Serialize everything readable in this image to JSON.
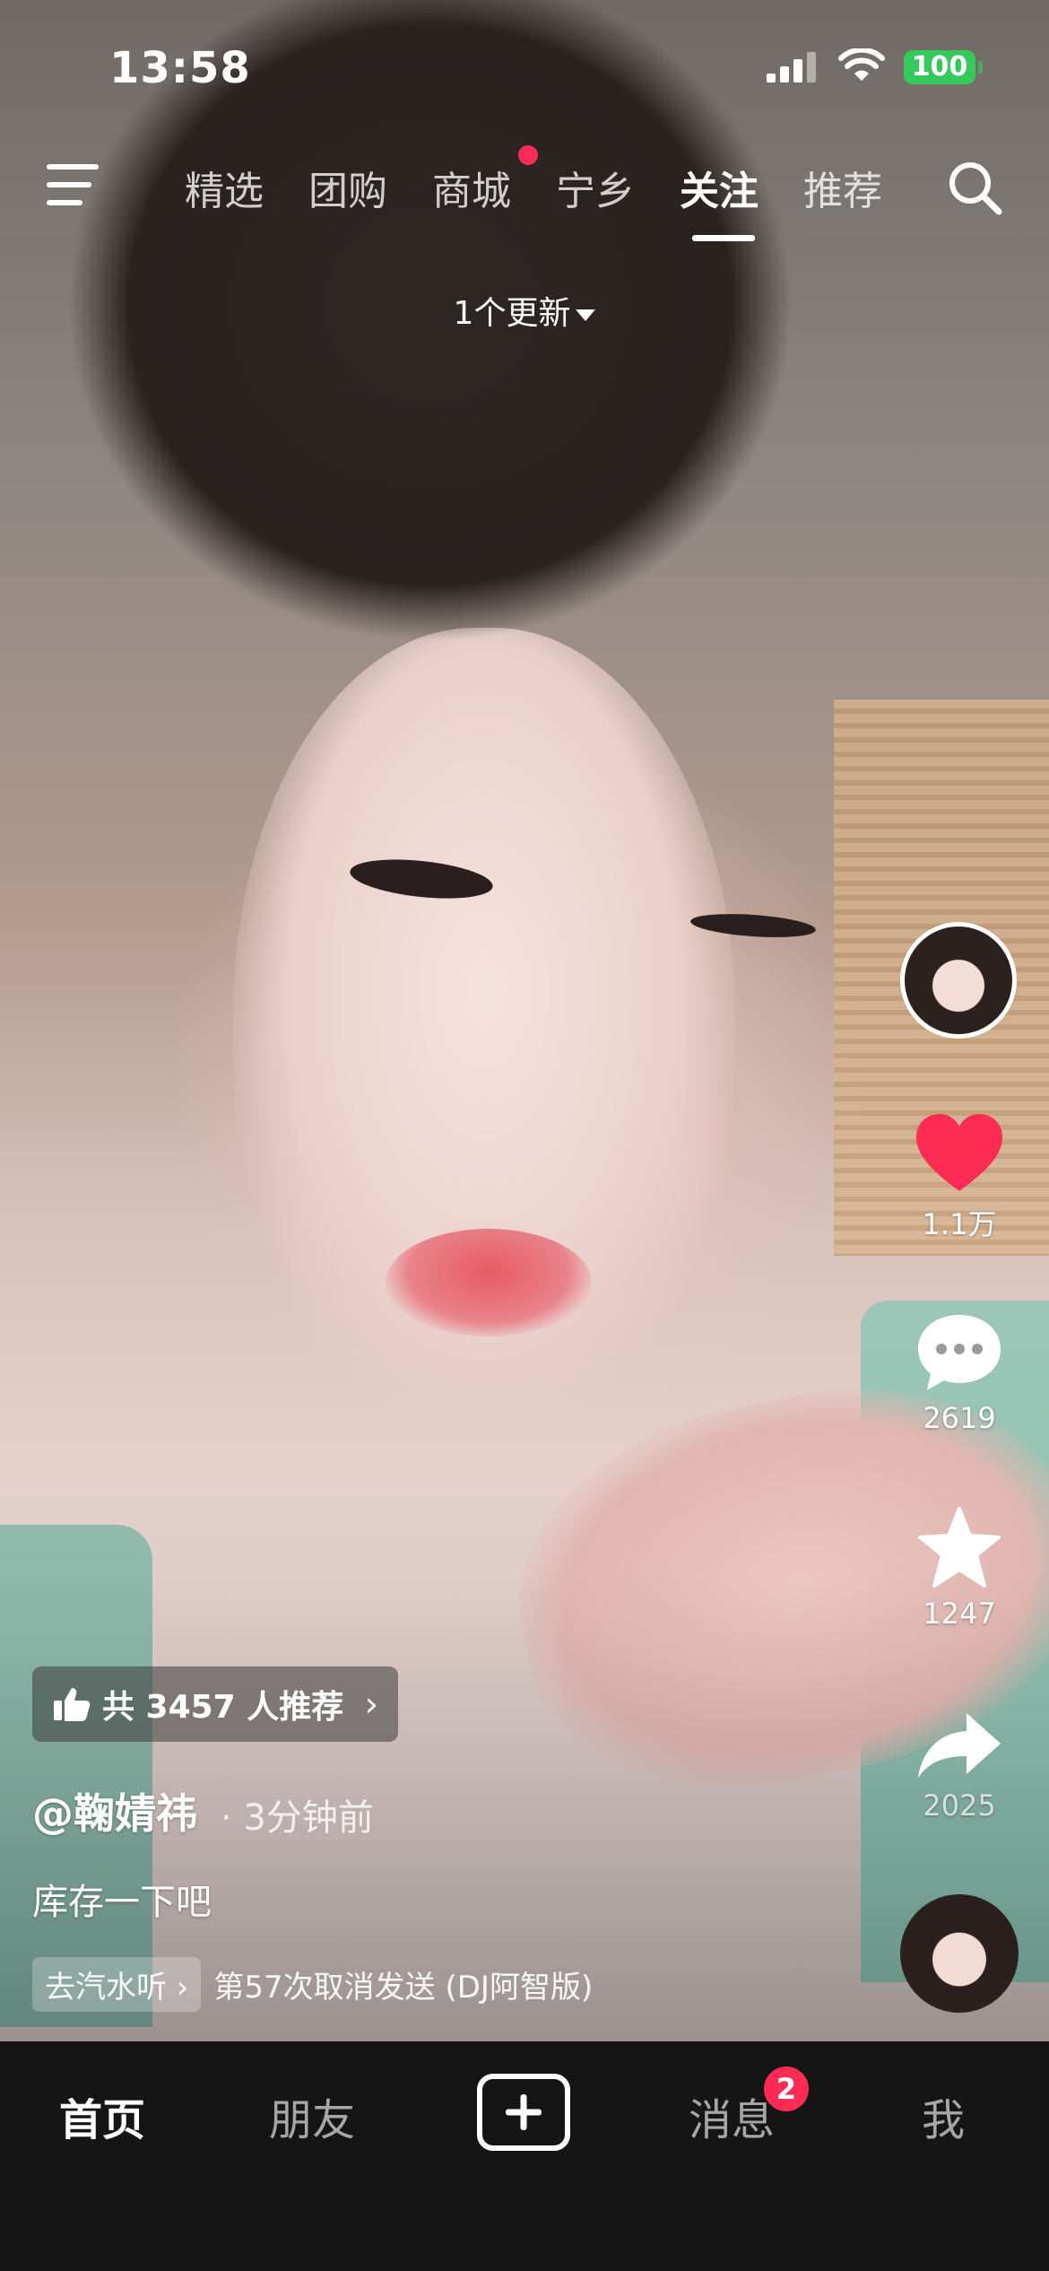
{
  "status_bar": {
    "time": "13:58",
    "battery": "100"
  },
  "top_nav": {
    "tabs": [
      {
        "label": "精选"
      },
      {
        "label": "团购"
      },
      {
        "label": "商城"
      },
      {
        "label": "宁乡"
      },
      {
        "label": "关注"
      },
      {
        "label": "推荐"
      }
    ],
    "active_tab": "关注"
  },
  "update_banner": {
    "text": "1个更新"
  },
  "right_rail": {
    "likes": "1.1万",
    "comments": "2619",
    "favorites": "1247",
    "shares": "2025"
  },
  "post": {
    "recommend_text": "共 3457 人推荐",
    "author": "@鞠婧祎",
    "time": "· 3分钟前",
    "caption": "库存一下吧",
    "music_tag": "去汽水听",
    "music_title": "第57次取消发送 (DJ阿智版)"
  },
  "bottom_nav": {
    "home": "首页",
    "friends": "朋友",
    "messages": "消息",
    "messages_badge": "2",
    "me": "我"
  },
  "colors": {
    "accent": "#fe2c55",
    "battery": "#35c85a",
    "nav_bg": "#151515"
  }
}
